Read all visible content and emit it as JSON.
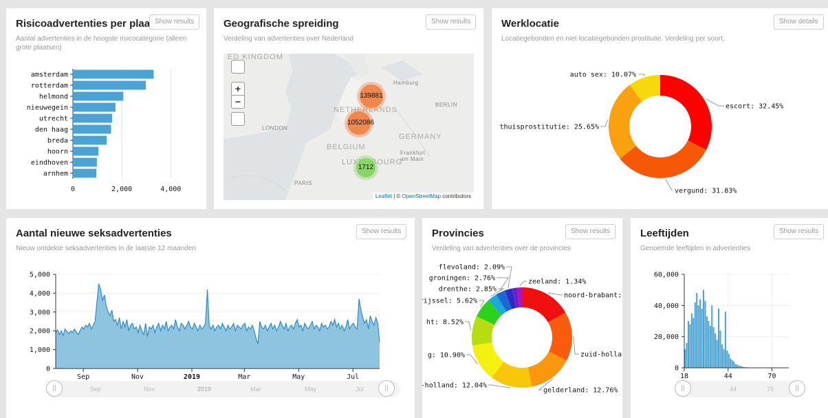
{
  "cards": {
    "risico": {
      "title": "Risicoadvertenties per plaats",
      "subtitle": "Aantal advertenties in de hoogste risicocategorie (alleen grote plaatsen)",
      "button": "Show results"
    },
    "geo": {
      "title": "Geografische spreiding",
      "subtitle": "Verdeling van advertenties over Nederland",
      "button": "Show results"
    },
    "werk": {
      "title": "Werklocatie",
      "subtitle": "Locatiegebonden en niet-locatiegebonden prostitutie. Verdeling per soort.",
      "button": "Show details"
    },
    "nieuw": {
      "title": "Aantal nieuwe seksadvertenties",
      "subtitle": "Nieuw ontdekte seksadvertenties in de laatste 12 maanden",
      "button": "Show results"
    },
    "prov": {
      "title": "Provincies",
      "subtitle": "Verdeling van advertenties over de provincies",
      "button": "Show results"
    },
    "leef": {
      "title": "Leeftijden",
      "subtitle": "Genoemde leeftijden in advertenties",
      "button": "Show results"
    }
  },
  "map": {
    "zoom_in": "+",
    "zoom_out": "−",
    "fullscreen_icon": "fullscreen-icon",
    "locate_icon": "globe-icon",
    "labels": {
      "kingdom": "ED KINGDOM",
      "netherlands": "NETHERLANDS",
      "belgium": "BELGIUM",
      "germany": "GERMANY",
      "luxembourg": "LUXEMBOURG",
      "hamburg": "Hamburg",
      "berlin": "BERLIN",
      "london": "LONDON",
      "frankfurt": "Frankfurt am Main",
      "paris": "PARIS"
    },
    "clusters": [
      {
        "value": "139881",
        "color": "#f0884e"
      },
      {
        "value": "1052086",
        "color": "#f0884e"
      },
      {
        "value": "1712",
        "color": "#8bd46a"
      }
    ],
    "attribution": {
      "leaflet": "Leaflet",
      "sep": " | © ",
      "osm": "OpenStreetMap",
      "rest": " contributors"
    }
  },
  "time_scroll": {
    "labels": [
      "Sep",
      "Nov",
      "2019",
      "Mar",
      "May",
      "Jul"
    ]
  },
  "age_scroll": {
    "labels": [
      "44",
      "70"
    ]
  },
  "chart_data": [
    {
      "id": "risico",
      "type": "bar",
      "orientation": "horizontal",
      "categories": [
        "amsterdam",
        "rotterdam",
        "helmond",
        "nieuwegein",
        "utrecht",
        "den haag",
        "breda",
        "hoorn",
        "eindhoven",
        "arnhem"
      ],
      "values": [
        3300,
        2980,
        2060,
        1740,
        1600,
        1560,
        1380,
        1040,
        980,
        960
      ],
      "xlim": [
        0,
        4300
      ],
      "xticks": [
        0,
        2000,
        4000
      ],
      "xtick_labels": [
        "0",
        "2,000",
        "4,000"
      ],
      "color": "#4ba3d3"
    },
    {
      "id": "werk",
      "type": "pie",
      "donut": true,
      "slices": [
        {
          "label": "escort: 32.45%",
          "value": 32.45,
          "color": "#f00"
        },
        {
          "label": "vergund: 31.83%",
          "value": 31.83,
          "color": "#f75806"
        },
        {
          "label": "thuisprostitutie: 25.65%",
          "value": 25.65,
          "color": "#f9a10e"
        },
        {
          "label": "auto sex: 10.07%",
          "value": 10.07,
          "color": "#f7d80d"
        }
      ]
    },
    {
      "id": "nieuw",
      "type": "area",
      "ylim": [
        0,
        5000
      ],
      "yticks": [
        0,
        1000,
        2000,
        3000,
        4000,
        5000
      ],
      "ytick_labels": [
        "0",
        "1,000",
        "2,000",
        "3,000",
        "4,000",
        "5,000"
      ],
      "xtick_labels": [
        "Sep",
        "Nov",
        "2019",
        "Mar",
        "May",
        "Jul"
      ],
      "x_start": "2018-08-01",
      "x_end": "2019-07-31",
      "values": [
        1900,
        2050,
        1800,
        2000,
        1750,
        2100,
        1950,
        1850,
        2000,
        1900,
        2100,
        1950,
        1800,
        2000,
        2200,
        2100,
        2300,
        2200,
        2400,
        2100,
        2300,
        2500,
        3500,
        4500,
        4200,
        3600,
        3900,
        3300,
        3000,
        2800,
        3100,
        2500,
        2600,
        2300,
        2700,
        2100,
        2500,
        2200,
        2600,
        2000,
        2300,
        2400,
        2100,
        2200,
        1900,
        2300,
        2000,
        1800,
        2400,
        1700,
        2200,
        2100,
        2300,
        1900,
        2200,
        2400,
        2000,
        2300,
        2100,
        2500,
        2000,
        2200,
        2300,
        2100,
        2600,
        2200,
        2000,
        2400,
        2300,
        2100,
        2300,
        2500,
        2200,
        2100,
        2400,
        2200,
        2000,
        2300,
        2100,
        2200,
        2400,
        4200,
        2300,
        2100,
        2300,
        2000,
        2200,
        2300,
        2100,
        2400,
        2200,
        2000,
        2300,
        2100,
        2200,
        2400,
        2000,
        2300,
        2200,
        2100,
        2300,
        2400,
        2000,
        2200,
        2100,
        2300,
        2000,
        1600,
        1300,
        2500,
        2200,
        2100,
        2300,
        2000,
        2200,
        2400,
        2100,
        2300,
        2000,
        2200,
        2500,
        2300,
        2100,
        2400,
        2000,
        2200,
        2300,
        2100,
        2400,
        2600,
        2200,
        2300,
        2000,
        2400,
        2200,
        2100,
        2300,
        2500,
        2100,
        2300,
        2200,
        2000,
        2400,
        2200,
        2300,
        2100,
        2200,
        2500,
        2300,
        2600,
        2200,
        2400,
        2100,
        2300,
        2000,
        2200,
        2600,
        2100,
        2300,
        2400,
        2200,
        2100,
        3700,
        3100,
        2700,
        2400,
        2600,
        2100,
        2800,
        2500,
        2300,
        2700,
        2400,
        1400
      ]
    },
    {
      "id": "prov",
      "type": "pie",
      "donut": true,
      "slices": [
        {
          "label": "noord-brabant: :",
          "value": 14.9,
          "color": "#f01010"
        },
        {
          "label": "zuid-hollar",
          "value": 14.3,
          "color": "#f95c0d"
        },
        {
          "label": "gelderland: 12.76%",
          "value": 12.76,
          "color": "#f9980e"
        },
        {
          "label": "·d-holland: 12.04%",
          "value": 12.04,
          "color": "#f8c70c"
        },
        {
          "label": "g: 10.90%",
          "value": 10.9,
          "color": "#f4f00f"
        },
        {
          "label": "ht: 8.52%",
          "value": 8.52,
          "color": "#b7dc10"
        },
        {
          "label": "rijssel: 5.62%",
          "value": 5.62,
          "color": "#2bd11a"
        },
        {
          "label": "drenthe: 2.85%",
          "value": 2.85,
          "color": "#1aaad8"
        },
        {
          "label": "groningen: 2.76%",
          "value": 2.76,
          "color": "#1c66d6"
        },
        {
          "label": "flevoland: 2.09%",
          "value": 2.09,
          "color": "#2d2ac4"
        },
        {
          "label": "",
          "value": 1.5,
          "color": "#6d1fc8"
        },
        {
          "label": "zeeland: 1.34%",
          "value": 1.34,
          "color": "#b013b8"
        }
      ]
    },
    {
      "id": "leef",
      "type": "bar",
      "histogram": true,
      "xlim": [
        18,
        80
      ],
      "xticks": [
        18,
        44,
        70
      ],
      "ylim": [
        0,
        60000
      ],
      "yticks": [
        0,
        20000,
        40000,
        60000
      ],
      "ytick_labels": [
        "0",
        "20,000",
        "40,000",
        "60,000"
      ],
      "x": [
        18,
        19,
        20,
        21,
        22,
        23,
        24,
        25,
        26,
        27,
        28,
        29,
        30,
        31,
        32,
        33,
        34,
        35,
        36,
        37,
        38,
        39,
        40,
        41,
        42,
        43,
        44,
        45,
        46,
        47,
        48,
        49,
        50,
        51,
        52,
        53,
        54,
        55,
        56,
        57,
        58,
        59,
        60
      ],
      "values": [
        12000,
        16000,
        30000,
        28000,
        35000,
        32000,
        42000,
        48000,
        40000,
        44000,
        38000,
        50000,
        43000,
        33000,
        30000,
        27000,
        40000,
        26000,
        22000,
        18000,
        38000,
        24000,
        15000,
        12000,
        36000,
        11000,
        9000,
        6000,
        5000,
        4000,
        2500,
        2000,
        1500,
        1200,
        800,
        500,
        400,
        300,
        200,
        150,
        100,
        80,
        50
      ],
      "color": "#4ba3d3"
    }
  ]
}
